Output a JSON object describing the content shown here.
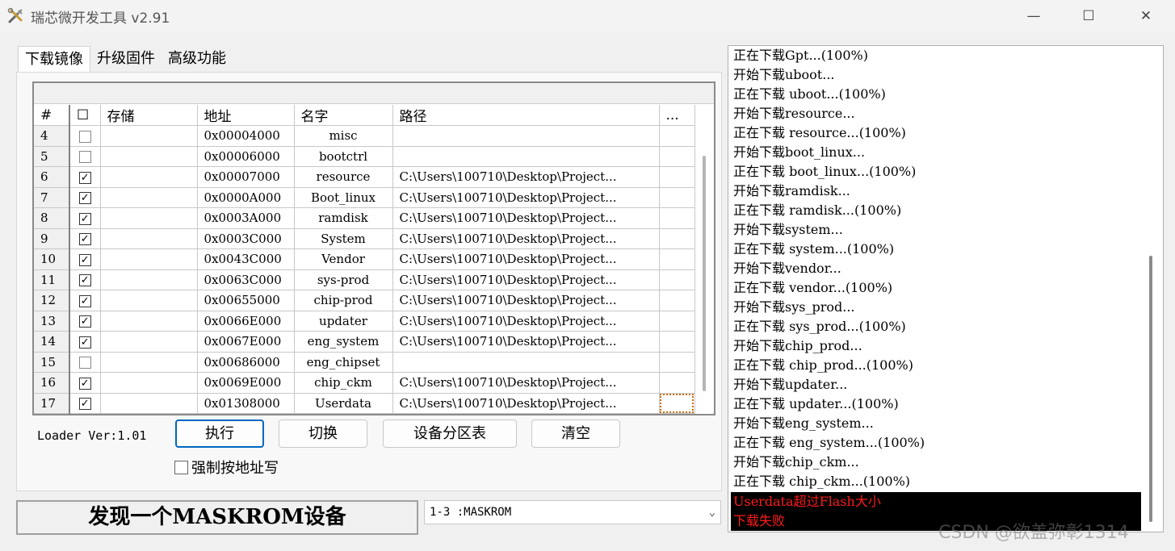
{
  "window": {
    "title": "瑞芯微开发工具 v2.91",
    "minimize": "—",
    "maximize": "☐",
    "close": "✕"
  },
  "tabs": [
    {
      "label": "下载镜像",
      "active": true
    },
    {
      "label": "升级固件",
      "active": false
    },
    {
      "label": "高级功能",
      "active": false
    }
  ],
  "grid": {
    "headers": {
      "num": "#",
      "check": "☐",
      "storage": "存储",
      "address": "地址",
      "name": "名字",
      "path": "路径",
      "more": "..."
    },
    "rows": [
      {
        "num": "4",
        "checked": false,
        "storage": "",
        "address": "0x00004000",
        "name": "misc",
        "path": ""
      },
      {
        "num": "5",
        "checked": false,
        "storage": "",
        "address": "0x00006000",
        "name": "bootctrl",
        "path": ""
      },
      {
        "num": "6",
        "checked": true,
        "storage": "",
        "address": "0x00007000",
        "name": "resource",
        "path": "C:\\Users\\100710\\Desktop\\Project..."
      },
      {
        "num": "7",
        "checked": true,
        "storage": "",
        "address": "0x0000A000",
        "name": "Boot_linux",
        "path": "C:\\Users\\100710\\Desktop\\Project..."
      },
      {
        "num": "8",
        "checked": true,
        "storage": "",
        "address": "0x0003A000",
        "name": "ramdisk",
        "path": "C:\\Users\\100710\\Desktop\\Project..."
      },
      {
        "num": "9",
        "checked": true,
        "storage": "",
        "address": "0x0003C000",
        "name": "System",
        "path": "C:\\Users\\100710\\Desktop\\Project..."
      },
      {
        "num": "10",
        "checked": true,
        "storage": "",
        "address": "0x0043C000",
        "name": "Vendor",
        "path": "C:\\Users\\100710\\Desktop\\Project..."
      },
      {
        "num": "11",
        "checked": true,
        "storage": "",
        "address": "0x0063C000",
        "name": "sys-prod",
        "path": "C:\\Users\\100710\\Desktop\\Project..."
      },
      {
        "num": "12",
        "checked": true,
        "storage": "",
        "address": "0x00655000",
        "name": "chip-prod",
        "path": "C:\\Users\\100710\\Desktop\\Project..."
      },
      {
        "num": "13",
        "checked": true,
        "storage": "",
        "address": "0x0066E000",
        "name": "updater",
        "path": "C:\\Users\\100710\\Desktop\\Project..."
      },
      {
        "num": "14",
        "checked": true,
        "storage": "",
        "address": "0x0067E000",
        "name": "eng_system",
        "path": "C:\\Users\\100710\\Desktop\\Project..."
      },
      {
        "num": "15",
        "checked": false,
        "storage": "",
        "address": "0x00686000",
        "name": "eng_chipset",
        "path": ""
      },
      {
        "num": "16",
        "checked": true,
        "storage": "",
        "address": "0x0069E000",
        "name": "chip_ckm",
        "path": "C:\\Users\\100710\\Desktop\\Project..."
      },
      {
        "num": "17",
        "checked": true,
        "storage": "",
        "address": "0x01308000",
        "name": "Userdata",
        "path": "C:\\Users\\100710\\Desktop\\Project..."
      }
    ]
  },
  "loader_version": "Loader Ver:1.01",
  "buttons": {
    "execute": "执行",
    "switch": "切换",
    "partition_table": "设备分区表",
    "clear": "清空"
  },
  "force_address_write": {
    "label": "强制按地址写",
    "checked": false
  },
  "status_text": "发现一个MASKROM设备",
  "device_select": {
    "value": "1-3 :MASKROM"
  },
  "log": {
    "lines": [
      "正在下载Gpt...(100%)",
      "开始下载uboot...",
      "正在下载 uboot...(100%)",
      "开始下载resource...",
      "正在下载 resource...(100%)",
      "开始下载boot_linux...",
      "正在下载 boot_linux...(100%)",
      "开始下载ramdisk...",
      "正在下载 ramdisk...(100%)",
      "开始下载system...",
      "正在下载 system...(100%)",
      "开始下载vendor...",
      "正在下载 vendor...(100%)",
      "开始下载sys_prod...",
      "正在下载 sys_prod...(100%)",
      "开始下载chip_prod...",
      "正在下载 chip_prod...(100%)",
      "开始下载updater...",
      "正在下载 updater...(100%)",
      "开始下载eng_system...",
      "正在下载 eng_system...(100%)",
      "开始下载chip_ckm...",
      "正在下载 chip_ckm...(100%)"
    ],
    "error_lines": [
      "Userdata超过Flash大小",
      "下载失败"
    ],
    "error_color": "#ff1a1a"
  },
  "watermark": "CSDN @欲盖弥彰1314"
}
